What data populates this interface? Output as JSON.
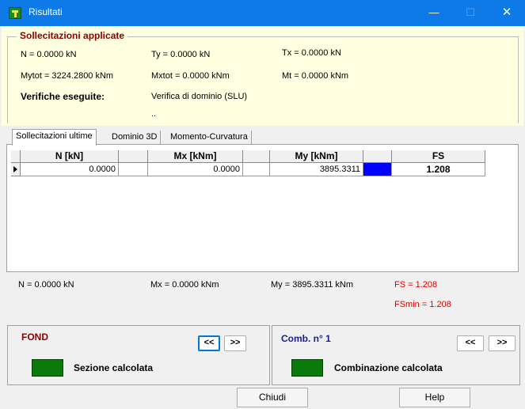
{
  "window": {
    "title": "Risultati",
    "controls": {
      "minimize": "—",
      "maximize": "☐",
      "close": "✕"
    }
  },
  "applied": {
    "legend": "Sollecitazioni applicate",
    "N": "N = 0.0000 kN",
    "Ty": "Ty = 0.0000 kN",
    "Tx": "Tx = 0.0000 kN",
    "Mytot": "Mytot = 3224.2800 kNm",
    "Mxtot": "Mxtot = 0.0000 kNm",
    "Mt": "Mt = 0.0000 kNm",
    "verifiche_label": "Verifiche eseguite:",
    "verifiche_value": "Verifica di dominio (SLU)",
    "extra": ".."
  },
  "tabs": [
    {
      "label": "Sollecitazioni ultime",
      "active": true
    },
    {
      "label": "Dominio 3D",
      "active": false
    },
    {
      "label": "Momento-Curvatura",
      "active": false
    }
  ],
  "grid": {
    "headers": {
      "N": "N [kN]",
      "Mx": "Mx [kNm]",
      "My": "My [kNm]",
      "FS": "FS"
    },
    "rows": [
      {
        "N": "0.0000",
        "Mx": "0.0000",
        "My": "3895.3311",
        "FS": "1.208",
        "status_color": "#0000ff"
      }
    ]
  },
  "results": {
    "N": "N = 0.0000 kN",
    "Mx": "Mx = 0.0000 kNm",
    "My": "My = 3895.3311 kNm",
    "FS": "FS = 1.208",
    "FSmin": "FSmin = 1.208"
  },
  "fond_panel": {
    "title": "FOND",
    "prev": "<<",
    "next": ">>",
    "status": "Sezione calcolata",
    "status_color": "#0a7a0a"
  },
  "comb_panel": {
    "title": "Comb. n° 1",
    "prev": "<<",
    "next": ">>",
    "status": "Combinazione calcolata",
    "status_color": "#0a7a0a"
  },
  "footer": {
    "close_label": "Chiudi",
    "help_label": "Help"
  },
  "colors": {
    "titlebar": "#0d7ae8",
    "applied_bg": "#ffffe1",
    "accent_red": "#8b0000",
    "fs_red": "#e00000",
    "comb_blue": "#1c1c8c"
  }
}
